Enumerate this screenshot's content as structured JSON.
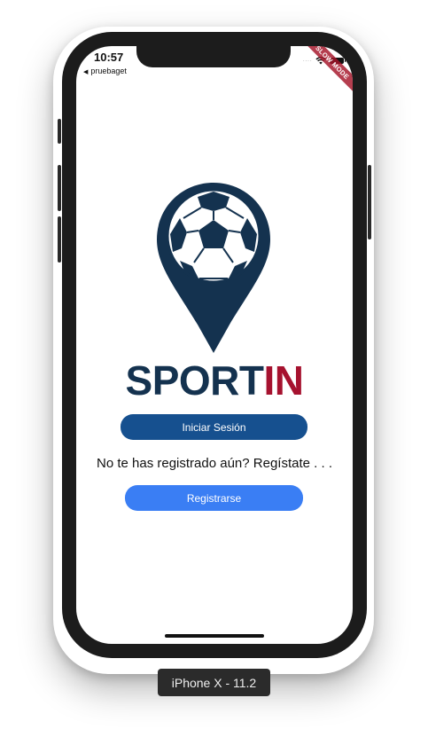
{
  "status_bar": {
    "time": "10:57",
    "back_app": "pruebaget",
    "back_icon": "back-triangle-icon",
    "wifi_icon": "wifi-icon",
    "battery_icon": "battery-icon"
  },
  "debug_banner": {
    "text": "SLOW MODE"
  },
  "app": {
    "brand_part1": "SPORT",
    "brand_part2": "IN",
    "brand_color_dark": "#14324f",
    "brand_color_accent": "#a6122f",
    "logo_icon": "map-pin-soccer-ball-icon",
    "login_button": "Iniciar Sesión",
    "register_prompt": "No te has registrado aún? Regístate . . .",
    "register_button": "Registrarse",
    "login_button_color": "#16508f",
    "register_button_color": "#3a7ef4"
  },
  "simulator": {
    "device_label": "iPhone X - 11.2"
  }
}
